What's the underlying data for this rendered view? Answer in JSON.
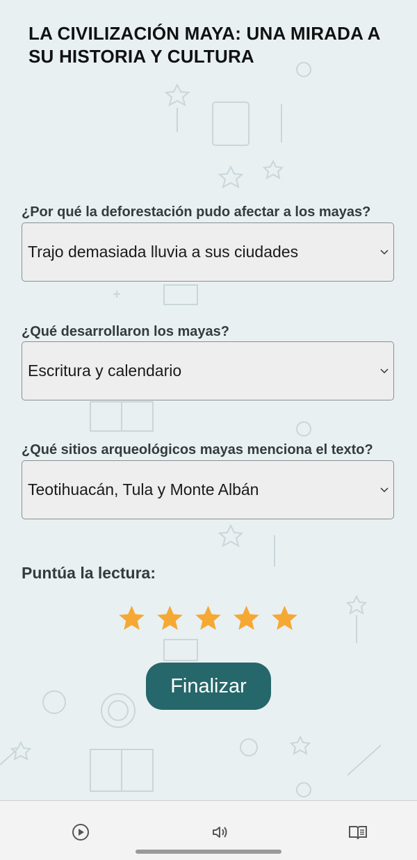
{
  "page": {
    "title": "LA CIVILIZACIÓN MAYA: UNA MIRADA A SU HISTORIA Y CULTURA"
  },
  "questions": [
    {
      "label": "¿Por qué la deforestación pudo afectar a los mayas?",
      "selected": "Trajo demasiada lluvia a sus ciudades"
    },
    {
      "label": "¿Qué desarrollaron los mayas?",
      "selected": "Escritura y calendario"
    },
    {
      "label": "¿Qué sitios arqueológicos mayas menciona el texto?",
      "selected": "Teotihuacán, Tula y Monte Albán"
    }
  ],
  "rating": {
    "label": "Puntúa la lectura:",
    "value": 5,
    "max": 5,
    "star_color": "#f5a833"
  },
  "finish_button": {
    "label": "Finalizar",
    "color": "#25676a"
  },
  "bottom_nav": {
    "icons": [
      "play-icon",
      "speaker-icon",
      "book-icon"
    ]
  }
}
